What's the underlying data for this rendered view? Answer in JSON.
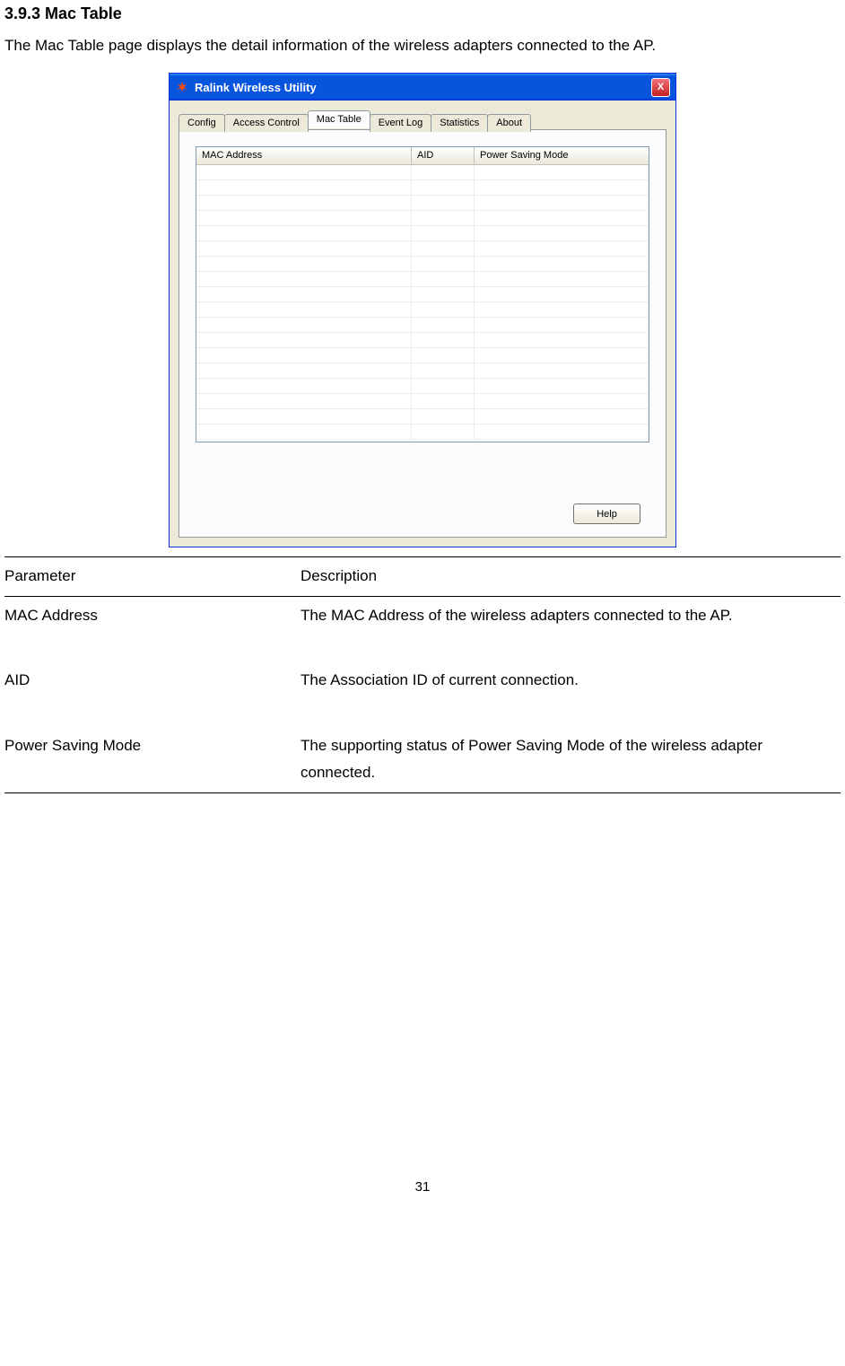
{
  "heading": "3.9.3   Mac Table",
  "intro": "The Mac Table page displays the detail information of the wireless adapters connected to the AP.",
  "dialog": {
    "title": "Ralink Wireless Utility",
    "close": "X",
    "tabs": [
      "Config",
      "Access Control",
      "Mac Table",
      "Event Log",
      "Statistics",
      "About"
    ],
    "active_tab_index": 2,
    "columns": [
      "MAC Address",
      "AID",
      "Power Saving Mode"
    ],
    "help_label": "Help"
  },
  "param_table": {
    "header": {
      "param": "Parameter",
      "desc": "Description"
    },
    "rows": [
      {
        "param": "MAC Address",
        "desc": "The MAC Address of the wireless adapters connected to the AP."
      },
      {
        "param": "AID",
        "desc": "The Association ID of current connection."
      },
      {
        "param": "Power Saving Mode",
        "desc": "The supporting status of Power Saving Mode of the wireless adapter connected."
      }
    ]
  },
  "page_number": "31"
}
